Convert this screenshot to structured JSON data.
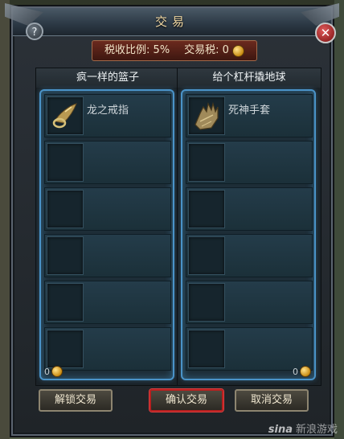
{
  "window": {
    "title": "交易",
    "help_label": "?",
    "close_label": "✕"
  },
  "tax": {
    "rate_label": "税收比例: 5%",
    "tax_label": "交易税: 0"
  },
  "left_panel": {
    "player_name": "疯一样的篮子",
    "items": [
      {
        "name": "龙之戒指",
        "icon": "ring-icon"
      },
      {
        "name": "",
        "icon": ""
      },
      {
        "name": "",
        "icon": ""
      },
      {
        "name": "",
        "icon": ""
      },
      {
        "name": "",
        "icon": ""
      },
      {
        "name": "",
        "icon": ""
      }
    ],
    "gold": "0"
  },
  "right_panel": {
    "player_name": "给个杠杆撬地球",
    "items": [
      {
        "name": "死神手套",
        "icon": "gauntlet-icon"
      },
      {
        "name": "",
        "icon": ""
      },
      {
        "name": "",
        "icon": ""
      },
      {
        "name": "",
        "icon": ""
      },
      {
        "name": "",
        "icon": ""
      },
      {
        "name": "",
        "icon": ""
      }
    ],
    "gold": "0"
  },
  "buttons": {
    "unlock": "解锁交易",
    "confirm": "确认交易",
    "cancel": "取消交易"
  },
  "watermark": {
    "logo": "sina",
    "text": "新浪游戏"
  },
  "colors": {
    "slot_glow": "#4a93c8",
    "confirm_border": "#b82020",
    "title_text": "#f2d9a4"
  }
}
